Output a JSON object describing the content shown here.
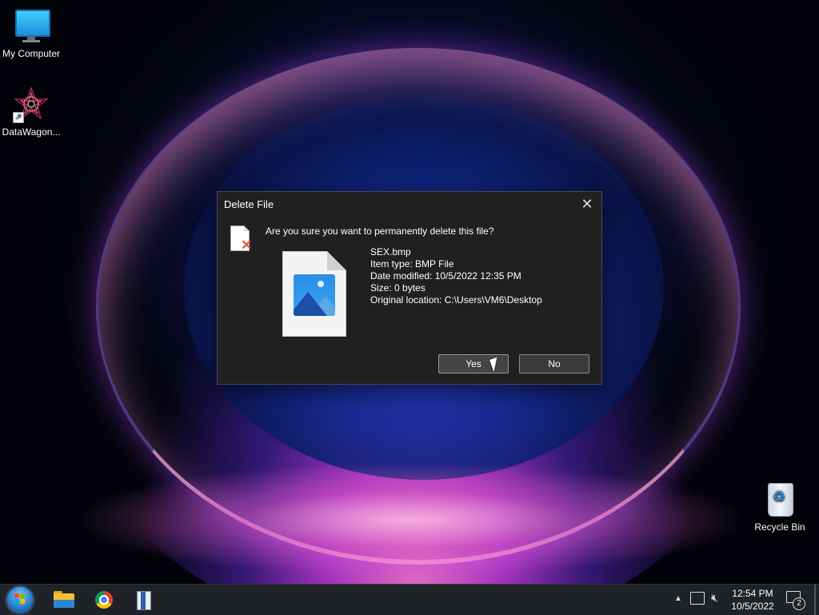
{
  "desktop": {
    "icons": [
      {
        "label": "My Computer"
      },
      {
        "label": "DataWagon..."
      },
      {
        "label": "Recycle Bin"
      }
    ]
  },
  "dialog": {
    "title": "Delete File",
    "close_glyph": "✕",
    "question": "Are you sure you want to permanently delete this file?",
    "file": {
      "name": "SEX.bmp",
      "type": "Item type: BMP File",
      "modified": "Date modified: 10/5/2022 12:35 PM",
      "size": "Size: 0 bytes",
      "location": "Original location: C:\\Users\\VM6\\Desktop"
    },
    "buttons": {
      "yes": "Yes",
      "no": "No"
    }
  },
  "taskbar": {
    "apps": [
      "start-button",
      "file-explorer",
      "google-chrome",
      "archive-app"
    ],
    "tray": {
      "time": "12:54 PM",
      "date": "10/5/2022",
      "notification_count": "2"
    }
  },
  "colors": {
    "dialog_bg": "#202020",
    "taskbar_bg": "#1f2328",
    "button_border": "#8a8a8a"
  }
}
